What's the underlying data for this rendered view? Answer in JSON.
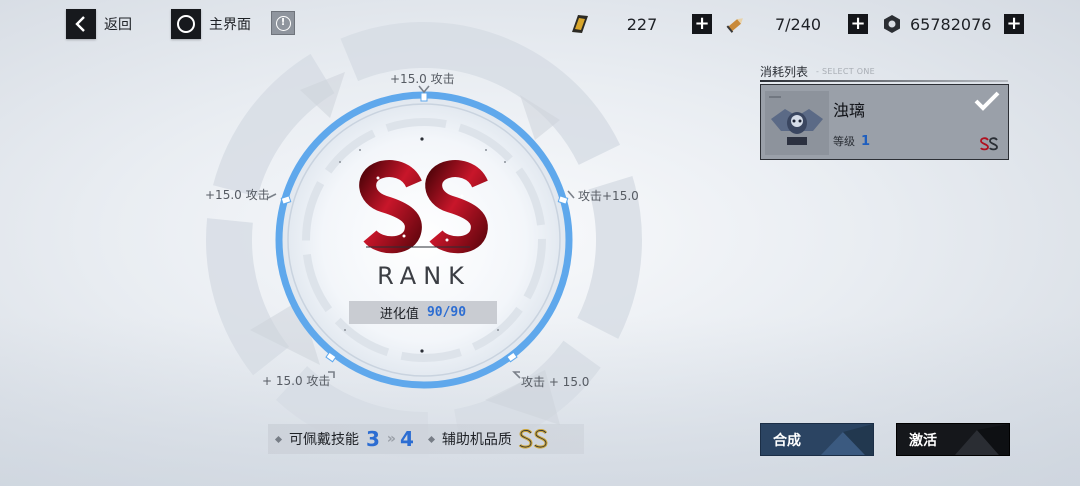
{
  "topbar": {
    "back_label": "返回",
    "home_label": "主界面",
    "info_glyph": "!"
  },
  "resources": [
    {
      "icon": "gold-bar-icon",
      "value": "227"
    },
    {
      "icon": "bullet-icon",
      "value": "7/240"
    },
    {
      "icon": "hex-nut-icon",
      "value": "65782076"
    }
  ],
  "attack_bonuses": {
    "top": "+15.0 攻击",
    "upper_left": "+15.0 攻击",
    "upper_right": "攻击+15.0",
    "lower_left": "+ 15.0 攻击",
    "lower_right": "攻击 + 15.0"
  },
  "rank": {
    "emblem_letters": "SS",
    "word": "RANK",
    "evolution_label": "进化值",
    "evolution_value": "90/90",
    "evolution_fraction": 1.0
  },
  "skills": {
    "label": "可佩戴技能",
    "from": "3",
    "to": "4",
    "arrow": "»",
    "aux_label": "辅助机品质",
    "aux_rank_icon": "ss-rank-icon"
  },
  "consumables": {
    "title": "消耗列表",
    "subtitle": "- SELECT ONE",
    "item": {
      "name": "浊璃",
      "level_label": "等级",
      "level_value": "1",
      "selected": true,
      "rank_icon": "ss-rank-icon"
    }
  },
  "actions": {
    "compose_label": "合成",
    "activate_label": "激活"
  },
  "colors": {
    "accent_blue": "#2c6dd2",
    "ring_blue": "#5fa8ec",
    "emblem_red": "#a3101d",
    "button_dark": "#15171b",
    "button_navy": "#2b4462"
  }
}
